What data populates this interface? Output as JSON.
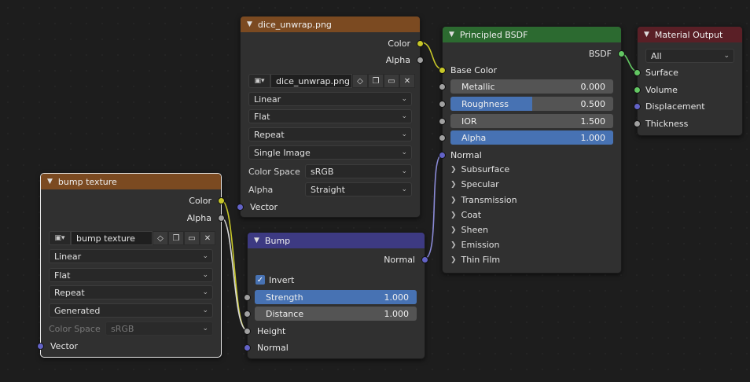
{
  "nodes": {
    "dice_image": {
      "title": "dice_unwrap.png",
      "outputs": [
        "Color",
        "Alpha"
      ],
      "image_name": "dice_unwrap.png",
      "interpolation": "Linear",
      "projection": "Flat",
      "extension": "Repeat",
      "source": "Single Image",
      "color_space_label": "Color Space",
      "color_space": "sRGB",
      "alpha_label": "Alpha",
      "alpha": "Straight",
      "vector_label": "Vector"
    },
    "bump_texture": {
      "title": "bump texture",
      "outputs": [
        "Color",
        "Alpha"
      ],
      "image_name": "bump texture",
      "interpolation": "Linear",
      "projection": "Flat",
      "extension": "Repeat",
      "source": "Generated",
      "color_space_label": "Color Space",
      "color_space": "sRGB",
      "vector_label": "Vector"
    },
    "bump": {
      "title": "Bump",
      "output": "Normal",
      "invert_label": "Invert",
      "invert": true,
      "strength_label": "Strength",
      "strength": "1.000",
      "distance_label": "Distance",
      "distance": "1.000",
      "height_label": "Height",
      "normal_label": "Normal"
    },
    "principled": {
      "title": "Principled BSDF",
      "output": "BSDF",
      "base_color": "Base Color",
      "metallic_label": "Metallic",
      "metallic": "0.000",
      "roughness_label": "Roughness",
      "roughness": "0.500",
      "roughness_fraction": 0.5,
      "ior_label": "IOR",
      "ior": "1.500",
      "alpha_label": "Alpha",
      "alpha": "1.000",
      "alpha_fraction": 1.0,
      "normal_label": "Normal",
      "panels": [
        "Subsurface",
        "Specular",
        "Transmission",
        "Coat",
        "Sheen",
        "Emission",
        "Thin Film"
      ]
    },
    "material_output": {
      "title": "Material Output",
      "target": "All",
      "inputs": [
        "Surface",
        "Volume",
        "Displacement",
        "Thickness"
      ]
    }
  },
  "colors": {
    "texture_header": "#7b4a21",
    "shader_header": "#2c6a30",
    "output_header": "#5a1f26",
    "vector_header": "#3d3a82",
    "color_socket": "#c7c729",
    "float_socket": "#a1a1a1",
    "vector_socket": "#6363c7",
    "shader_socket": "#63c763",
    "slider_fill": "#4772b3"
  }
}
